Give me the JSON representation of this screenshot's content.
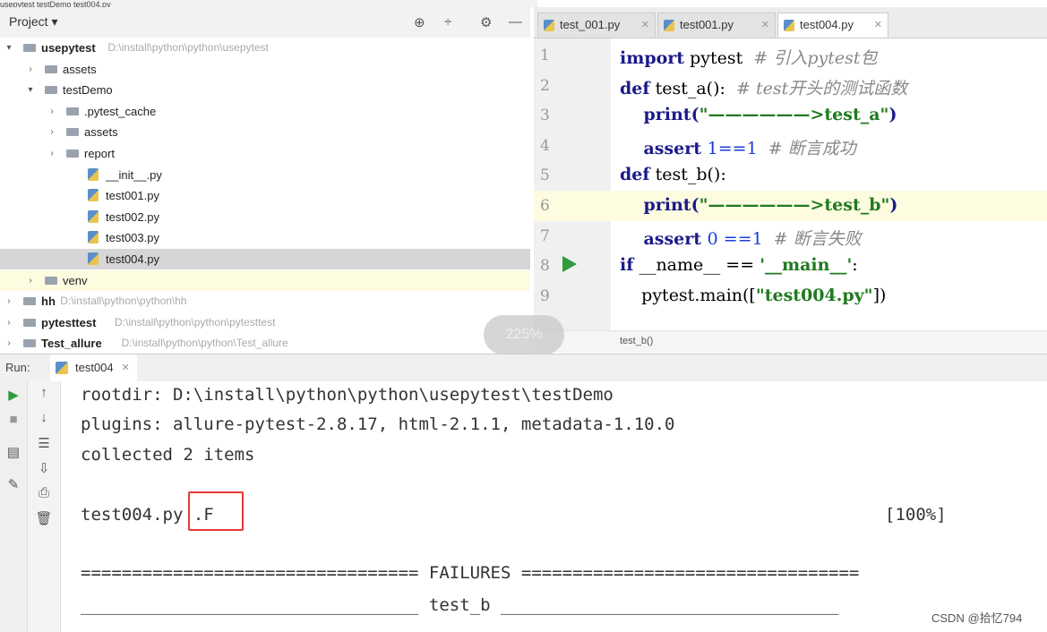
{
  "project_panel": {
    "crumb": "usepytest  testDemo  test004.py",
    "title": "Project ▾",
    "tools": [
      "⊕",
      "÷",
      "⚙",
      "—"
    ],
    "tree": [
      {
        "arrow": "▾",
        "type": "folder",
        "label": "usepytest",
        "path": "D:\\install\\python\\python\\usepytest",
        "bold": true,
        "indent": 0
      },
      {
        "arrow": "›",
        "type": "folder",
        "label": "assets",
        "path": "",
        "bold": false,
        "indent": 1
      },
      {
        "arrow": "▾",
        "type": "folder",
        "label": "testDemo",
        "path": "",
        "bold": false,
        "indent": 1
      },
      {
        "arrow": "›",
        "type": "folder",
        "label": ".pytest_cache",
        "path": "",
        "bold": false,
        "indent": 2
      },
      {
        "arrow": "›",
        "type": "folder",
        "label": "assets",
        "path": "",
        "bold": false,
        "indent": 2
      },
      {
        "arrow": "›",
        "type": "folder",
        "label": "report",
        "path": "",
        "bold": false,
        "indent": 2
      },
      {
        "arrow": "",
        "type": "py",
        "label": "__init__.py",
        "path": "",
        "bold": false,
        "indent": 3
      },
      {
        "arrow": "",
        "type": "py",
        "label": "test001.py",
        "path": "",
        "bold": false,
        "indent": 3
      },
      {
        "arrow": "",
        "type": "py",
        "label": "test002.py",
        "path": "",
        "bold": false,
        "indent": 3
      },
      {
        "arrow": "",
        "type": "py",
        "label": "test003.py",
        "path": "",
        "bold": false,
        "indent": 3
      },
      {
        "arrow": "",
        "type": "py",
        "label": "test004.py",
        "path": "",
        "bold": false,
        "indent": 3,
        "selected": true
      },
      {
        "arrow": "›",
        "type": "folder",
        "label": "venv",
        "path": "",
        "bold": false,
        "indent": 1,
        "highlight": true
      },
      {
        "arrow": "›",
        "type": "folder",
        "label": "hh",
        "path": "D:\\install\\python\\python\\hh",
        "bold": true,
        "indent": 0
      },
      {
        "arrow": "›",
        "type": "folder",
        "label": "pytesttest",
        "path": "D:\\install\\python\\python\\pytesttest",
        "bold": true,
        "indent": 0
      },
      {
        "arrow": "›",
        "type": "folder",
        "label": "Test_allure",
        "path": "D:\\install\\python\\python\\Test_allure",
        "bold": true,
        "indent": 0
      }
    ]
  },
  "editor": {
    "tabs": [
      {
        "label": "test_001.py",
        "active": false
      },
      {
        "label": "test001.py",
        "active": false
      },
      {
        "label": "test004.py",
        "active": true
      }
    ],
    "line_numbers": [
      "1",
      "2",
      "3",
      "4",
      "5",
      "6",
      "7",
      "8",
      "9"
    ],
    "lines": [
      [
        {
          "t": "import",
          "c": "kw"
        },
        {
          "t": " pytest  ",
          "c": ""
        },
        {
          "t": "# 引入pytest包",
          "c": "cmt"
        }
      ],
      [
        {
          "t": "def",
          "c": "kw"
        },
        {
          "t": " test_a():  ",
          "c": "fn"
        },
        {
          "t": "# test开头的测试函数",
          "c": "cmt"
        }
      ],
      [
        {
          "t": "    print(",
          "c": "kw"
        },
        {
          "t": "\"——————>test_a\"",
          "c": "str"
        },
        {
          "t": ")",
          "c": "kw"
        }
      ],
      [
        {
          "t": "    assert ",
          "c": "kw"
        },
        {
          "t": "1==1",
          "c": "num"
        },
        {
          "t": "  # 断言成功",
          "c": "cmt"
        }
      ],
      [
        {
          "t": "def",
          "c": "kw"
        },
        {
          "t": " test_b():",
          "c": "fn"
        }
      ],
      [
        {
          "t": "    print(",
          "c": "kw"
        },
        {
          "t": "\"——————>test_b\"",
          "c": "str"
        },
        {
          "t": ")",
          "c": "kw"
        }
      ],
      [
        {
          "t": "    assert ",
          "c": "kw"
        },
        {
          "t": "0 ==1",
          "c": "num"
        },
        {
          "t": "  # 断言失败",
          "c": "cmt"
        }
      ],
      [
        {
          "t": "if",
          "c": "kw"
        },
        {
          "t": " __name__ == ",
          "c": "fn"
        },
        {
          "t": "'__main__'",
          "c": "str"
        },
        {
          "t": ":",
          "c": "fn"
        }
      ],
      [
        {
          "t": "    pytest.main([",
          "c": "fn"
        },
        {
          "t": "\"test004.py\"",
          "c": "str"
        },
        {
          "t": "])",
          "c": "fn"
        }
      ]
    ],
    "status": "test_b()",
    "zoom": "225%"
  },
  "run_panel": {
    "label": "Run:",
    "tab": "test004",
    "console": [
      "rootdir: D:\\install\\python\\python\\usepytest\\testDemo",
      "plugins: allure-pytest-2.8.17, html-2.1.1, metadata-1.10.0",
      "collected 2 items",
      "",
      "test004.py .F",
      "",
      "================================= FAILURES =================================",
      "_________________________________ test_b _________________________________"
    ],
    "progress": "[100%]"
  },
  "watermark": "CSDN @拾忆794"
}
